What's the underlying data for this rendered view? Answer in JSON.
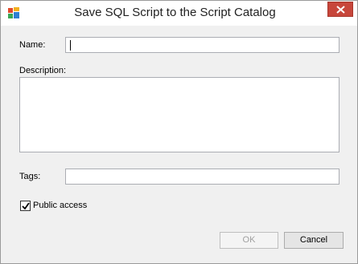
{
  "window": {
    "title": "Save SQL Script to the Script Catalog",
    "app_icon": "app-logo-icon",
    "close_icon": "close-icon"
  },
  "form": {
    "name_label": "Name:",
    "name_value": "",
    "description_label": "Description:",
    "description_value": "",
    "tags_label": "Tags:",
    "tags_value": "",
    "public_access_label": "Public access",
    "public_access_checked": true
  },
  "buttons": {
    "ok_label": "OK",
    "ok_enabled": false,
    "cancel_label": "Cancel"
  },
  "colors": {
    "close_button": "#c7463b",
    "dialog_background": "#f0f0f0"
  }
}
